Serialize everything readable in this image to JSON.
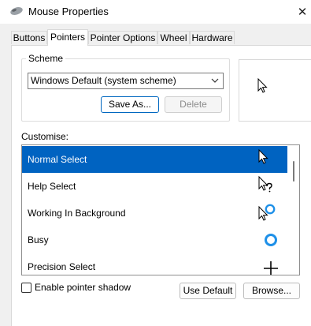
{
  "window": {
    "title": "Mouse Properties",
    "close_glyph": "✕"
  },
  "tabs": [
    {
      "label": "Buttons"
    },
    {
      "label": "Pointers"
    },
    {
      "label": "Pointer Options"
    },
    {
      "label": "Wheel"
    },
    {
      "label": "Hardware"
    }
  ],
  "active_tab": "Pointers",
  "scheme": {
    "legend": "Scheme",
    "selected": "Windows Default (system scheme)",
    "save_as_label": "Save As...",
    "delete_label": "Delete"
  },
  "customise": {
    "label": "Customise:",
    "items": [
      {
        "label": "Normal Select",
        "icon": "arrow-cursor-icon",
        "selected": true
      },
      {
        "label": "Help Select",
        "icon": "help-cursor-icon",
        "selected": false
      },
      {
        "label": "Working In Background",
        "icon": "working-cursor-icon",
        "selected": false
      },
      {
        "label": "Busy",
        "icon": "busy-ring-icon",
        "selected": false
      },
      {
        "label": "Precision Select",
        "icon": "crosshair-icon",
        "selected": false
      }
    ]
  },
  "shadow": {
    "label": "Enable pointer shadow",
    "checked": false
  },
  "buttons": {
    "use_default_label": "Use Default",
    "browse_label": "Browse..."
  },
  "colors": {
    "selection": "#0063c1",
    "busy_ring": "#1e90e8"
  }
}
